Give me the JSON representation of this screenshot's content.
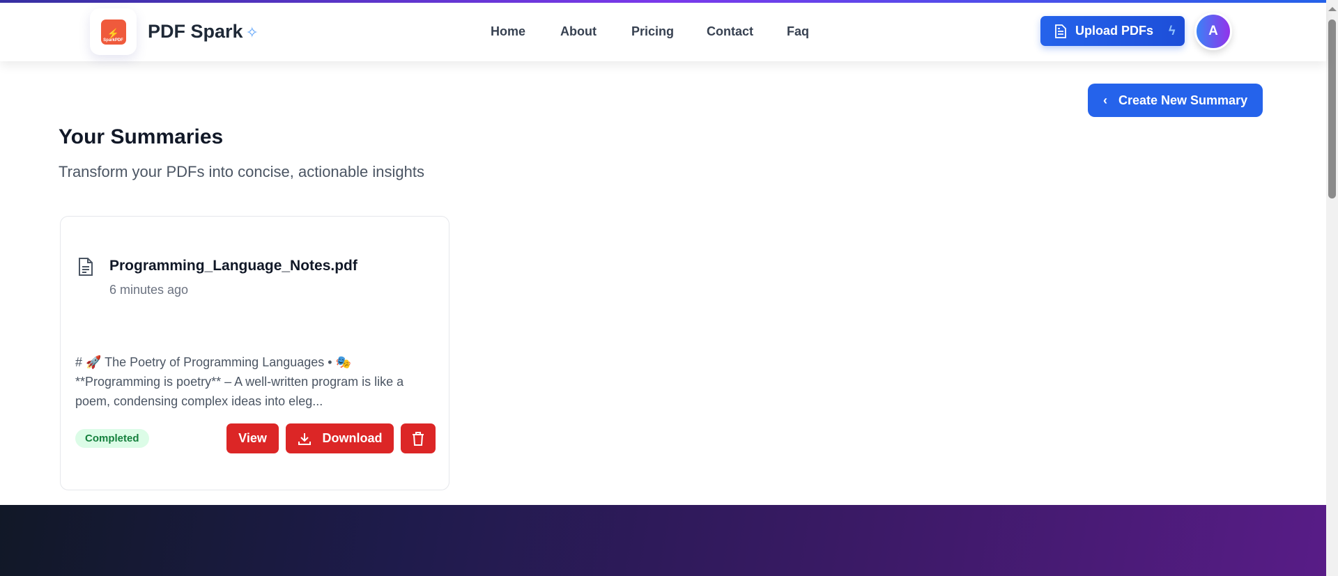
{
  "header": {
    "brand": "PDF Spark",
    "logo_text": "SparkPDF",
    "nav": [
      "Home",
      "About",
      "Pricing",
      "Contact",
      "Faq"
    ],
    "upload_label": "Upload PDFs",
    "avatar_initial": "A"
  },
  "main": {
    "create_label": "Create New Summary",
    "title": "Your Summaries",
    "subtitle": "Transform your PDFs into concise, actionable insights"
  },
  "summaries": [
    {
      "file_name": "Programming_Language_Notes.pdf",
      "time": "6 minutes ago",
      "preview_line1": "# 🚀 The Poetry of Programming Languages • 🎭",
      "preview_rest": "**Programming is poetry** – A well-written program is like a poem, condensing complex ideas into eleg...",
      "status": "Completed",
      "view_label": "View",
      "download_label": "Download"
    }
  ],
  "colors": {
    "primary": "#2563eb",
    "danger": "#dc2626",
    "success_bg": "#dcfce7"
  }
}
